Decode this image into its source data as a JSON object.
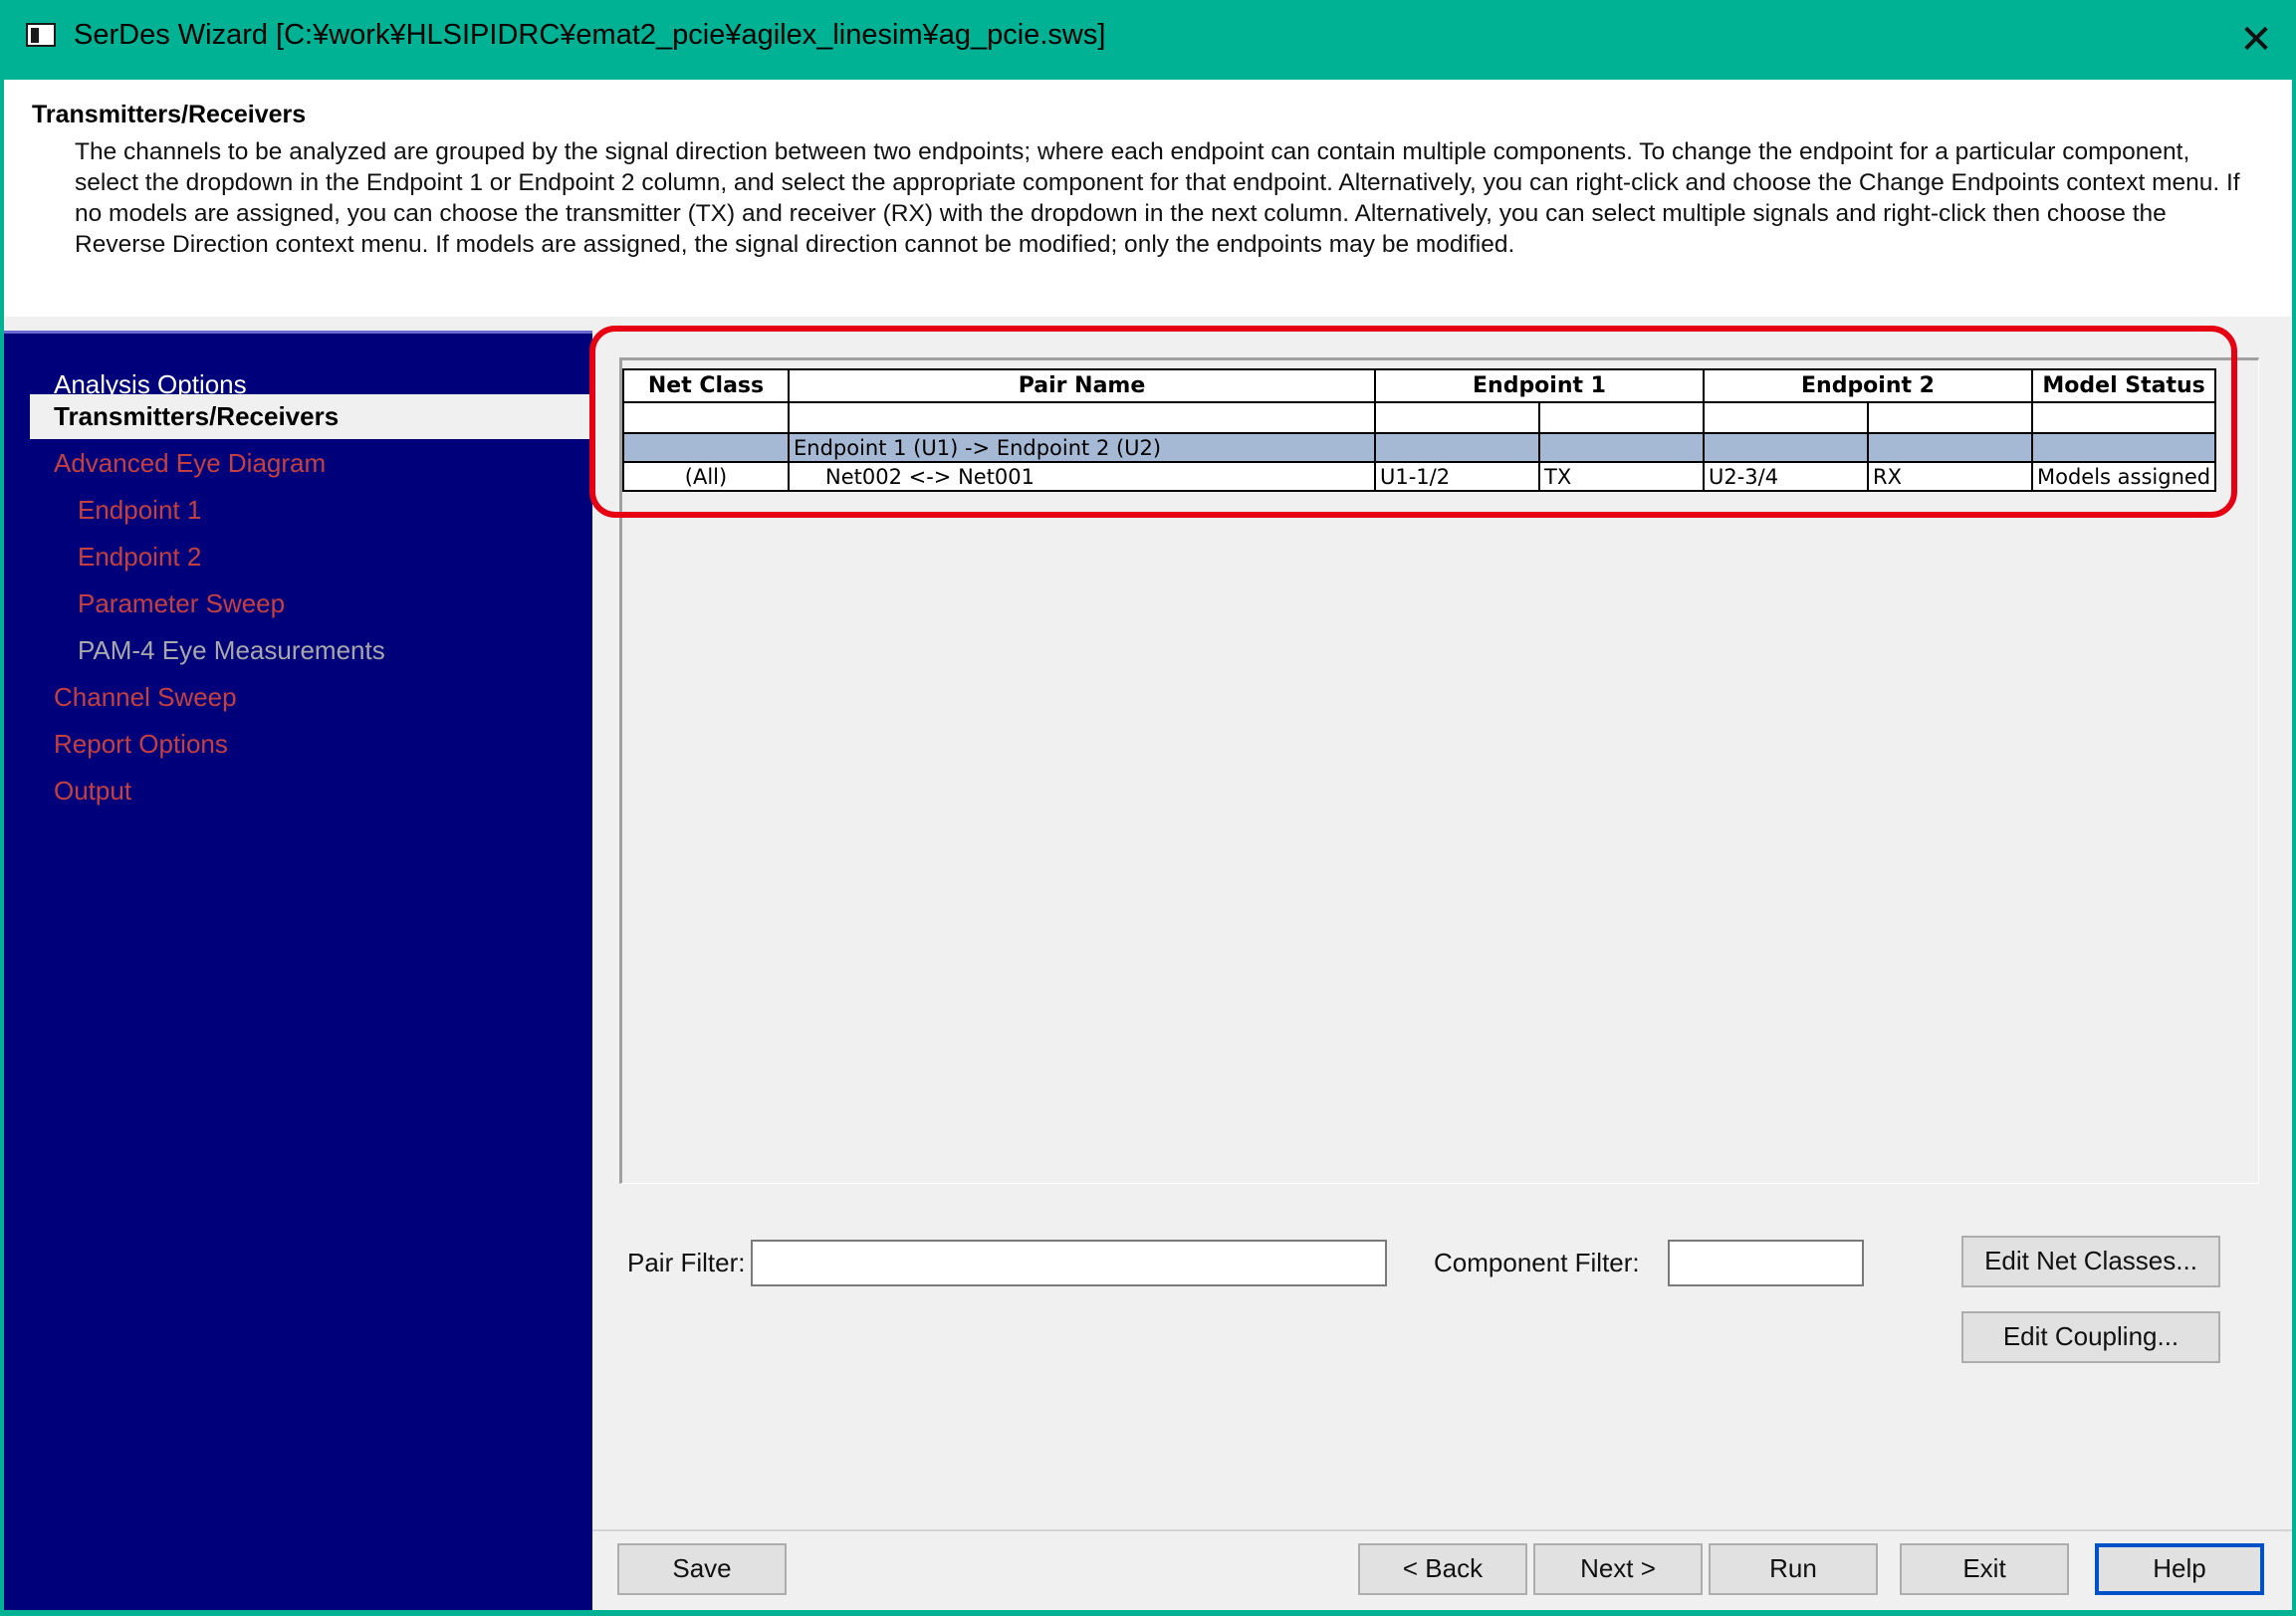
{
  "window": {
    "title": "SerDes Wizard [C:¥work¥HLSIPIDRC¥emat2_pcie¥agilex_linesim¥ag_pcie.sws]",
    "close_glyph": "✕"
  },
  "header": {
    "title": "Transmitters/Receivers",
    "description": "The channels to be analyzed are grouped by the signal direction between two endpoints; where each endpoint can contain multiple components.  To change the endpoint for a particular component, select the dropdown in the Endpoint 1 or Endpoint 2 column, and select the appropriate component for that endpoint.  Alternatively, you can right-click and choose the Change Endpoints context menu.  If no models are assigned, you can choose the transmitter (TX) and receiver (RX) with the dropdown in the next column.  Alternatively, you can select multiple signals and right-click then choose the Reverse Direction context menu.  If models are assigned, the signal direction cannot be modified; only the endpoints may be modified."
  },
  "sidebar": {
    "items": [
      {
        "label": "Analysis Options"
      },
      {
        "label": "Transmitters/Receivers"
      },
      {
        "label": "Advanced Eye Diagram"
      },
      {
        "label": "Endpoint 1"
      },
      {
        "label": "Endpoint 2"
      },
      {
        "label": "Parameter Sweep"
      },
      {
        "label": "PAM-4 Eye Measurements"
      },
      {
        "label": "Channel Sweep"
      },
      {
        "label": "Report Options"
      },
      {
        "label": "Output"
      }
    ]
  },
  "grid": {
    "columns": [
      "Net Class",
      "Pair Name",
      "Endpoint 1",
      "Endpoint 2",
      "Model Status"
    ],
    "group_label": "Endpoint 1 (U1) -> Endpoint 2 (U2)",
    "rows": [
      {
        "net_class": "(All)",
        "pair_name": "Net002 <-> Net001",
        "endpoint1_component": "U1-1/2",
        "endpoint1_role": "TX",
        "endpoint2_component": "U2-3/4",
        "endpoint2_role": "RX",
        "model_status": "Models assigned"
      }
    ]
  },
  "filters": {
    "pair_filter_label": "Pair Filter:",
    "pair_filter_value": "",
    "component_filter_label": "Component Filter:",
    "component_filter_value": ""
  },
  "buttons": {
    "edit_net_classes": "Edit Net Classes...",
    "edit_coupling": "Edit Coupling...",
    "save": "Save",
    "back": "< Back",
    "next": "Next >",
    "run": "Run",
    "exit": "Exit",
    "help": "Help"
  },
  "colors": {
    "titlebar": "#00b294",
    "sidebar": "#00007a",
    "sidebar_link": "#c44040",
    "group_row": "#a5b9d4",
    "highlight": "#e60012"
  }
}
